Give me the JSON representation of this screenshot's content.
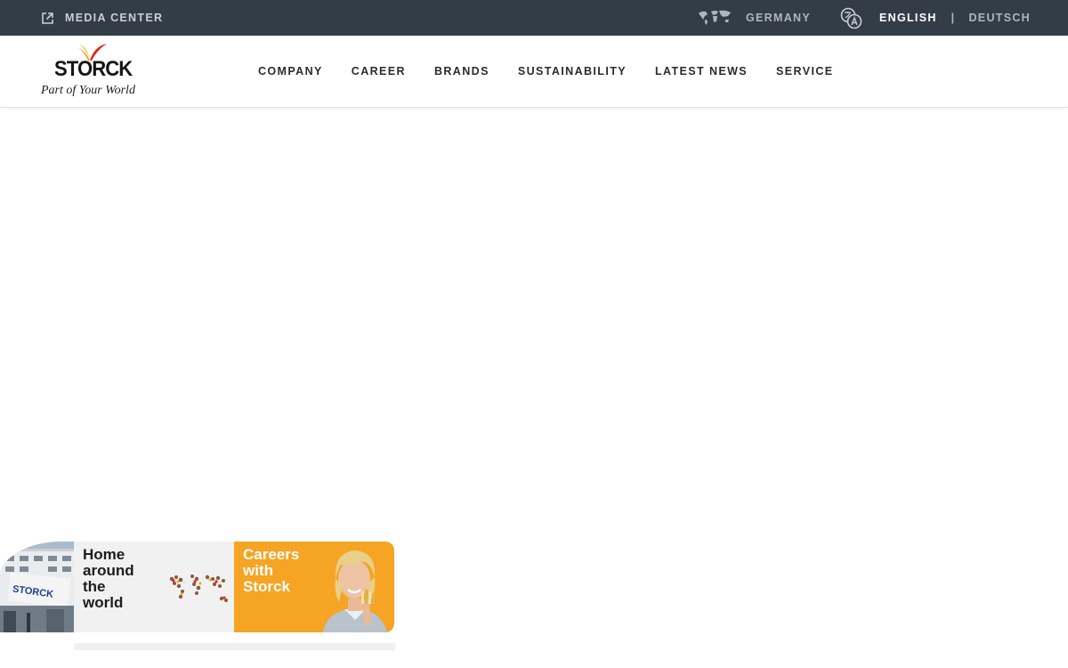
{
  "topbar": {
    "media_center": "MEDIA CENTER",
    "country": "GERMANY",
    "lang_active": "ENGLISH",
    "lang_separator": "|",
    "lang_other": "DEUTSCH"
  },
  "logo": {
    "wordmark": "STORCK",
    "tagline": "Part of Your World"
  },
  "nav": {
    "items": [
      "COMPANY",
      "CAREER",
      "BRANDS",
      "SUSTAINABILITY",
      "LATEST NEWS",
      "SERVICE"
    ]
  },
  "tiles": {
    "home": {
      "line1": "Home",
      "line2": "around",
      "line3": "the",
      "line4": "world"
    },
    "careers": {
      "line1": "Careers",
      "line2": "with",
      "line3": "Storck"
    },
    "photo_sign": "STORCK"
  },
  "colors": {
    "topbar": "#333d47",
    "accent_orange": "#f6a423",
    "logo_red": "#e2231a"
  }
}
